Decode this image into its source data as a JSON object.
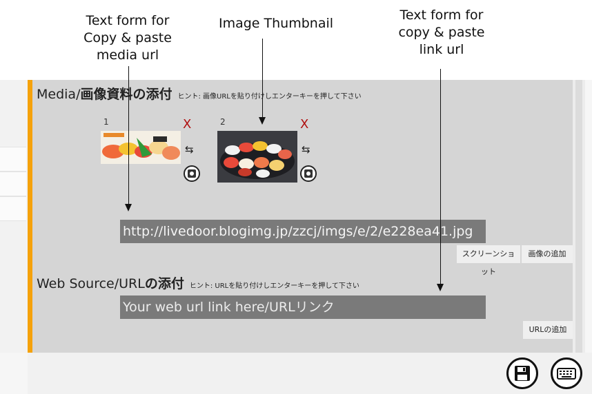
{
  "annotations": {
    "media_url_label": "Text form for\nCopy & paste\nmedia url",
    "thumbnail_label": "Image Thumbnail",
    "link_url_label": "Text form for\ncopy & paste\nlink url"
  },
  "media_section": {
    "title_prefix": "Media/",
    "title_jp": "画像資料の添付",
    "hint": "ヒント: 画像URLを貼り付けしエンターキーを押して下さい",
    "thumbnails": [
      {
        "index": "1",
        "remove": "X",
        "swap": "⇆"
      },
      {
        "index": "2",
        "remove": "X",
        "swap": "⇆"
      }
    ],
    "url_value": "http://livedoor.blogimg.jp/zzcj/imgs/e/2/e228ea41.jpg",
    "screenshot_button": "スクリーンショット",
    "add_image_button": "画像の追加"
  },
  "web_section": {
    "title_prefix": "Web Source/URL",
    "title_jp": "の添付",
    "hint": "ヒント: URLを貼り付けしエンターキーを押して下さい",
    "url_placeholder": "Your web url link here/URLリンク",
    "add_url_button": "URLの追加"
  },
  "toolbar": {
    "save_icon": "save-icon",
    "keyboard_icon": "keyboard-icon"
  },
  "colors": {
    "accent": "#f5a20b",
    "panel": "#d5d5d5",
    "field": "#7a7a7a",
    "remove": "#b01010"
  }
}
